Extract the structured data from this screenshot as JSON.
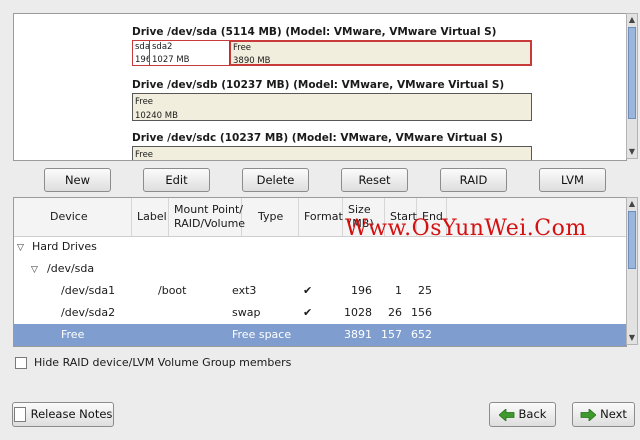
{
  "drives": [
    {
      "title": "Drive /dev/sda (5114 MB) (Model: VMware, VMware Virtual S)",
      "segments": [
        {
          "name": "sda",
          "size": "196"
        },
        {
          "name": "sda2",
          "size": "1027 MB"
        },
        {
          "name": "Free",
          "size": "3890 MB"
        }
      ]
    },
    {
      "title": "Drive /dev/sdb (10237 MB) (Model: VMware, VMware Virtual S)",
      "segments": [
        {
          "name": "Free",
          "size": "10240 MB"
        }
      ]
    },
    {
      "title": "Drive /dev/sdc (10237 MB) (Model: VMware, VMware Virtual S)",
      "segments": [
        {
          "name": "Free",
          "size": ""
        }
      ]
    }
  ],
  "actions": {
    "new": "New",
    "edit": "Edit",
    "delete": "Delete",
    "reset": "Reset",
    "raid": "RAID",
    "lvm": "LVM"
  },
  "table": {
    "headers": {
      "device": "Device",
      "label": "Label",
      "mount": "Mount Point/ RAID/Volume",
      "type": "Type",
      "format": "Format",
      "size": "Size (MB)",
      "start": "Start",
      "end": "End"
    },
    "rows": [
      {
        "device": "Hard Drives",
        "label": "",
        "mount": "",
        "type": "",
        "format": "",
        "size": "",
        "start": "",
        "end": ""
      },
      {
        "device": "/dev/sda",
        "label": "",
        "mount": "",
        "type": "",
        "format": "",
        "size": "",
        "start": "",
        "end": ""
      },
      {
        "device": "/dev/sda1",
        "label": "",
        "mount": "/boot",
        "type": "ext3",
        "format": "✔",
        "size": "196",
        "start": "1",
        "end": "25"
      },
      {
        "device": "/dev/sda2",
        "label": "",
        "mount": "",
        "type": "swap",
        "format": "✔",
        "size": "1028",
        "start": "26",
        "end": "156"
      },
      {
        "device": "Free",
        "label": "",
        "mount": "",
        "type": "Free space",
        "format": "",
        "size": "3891",
        "start": "157",
        "end": "652"
      }
    ]
  },
  "watermark": "Www.OsYunWei.Com",
  "hide_raid_label": "Hide RAID device/LVM Volume Group members",
  "footer": {
    "release_notes": "Release Notes",
    "back": "Back",
    "next": "Next"
  },
  "colors": {
    "selection": "#7f9ecf",
    "free_fill": "#f1eedd",
    "watermark": "#d41010"
  }
}
